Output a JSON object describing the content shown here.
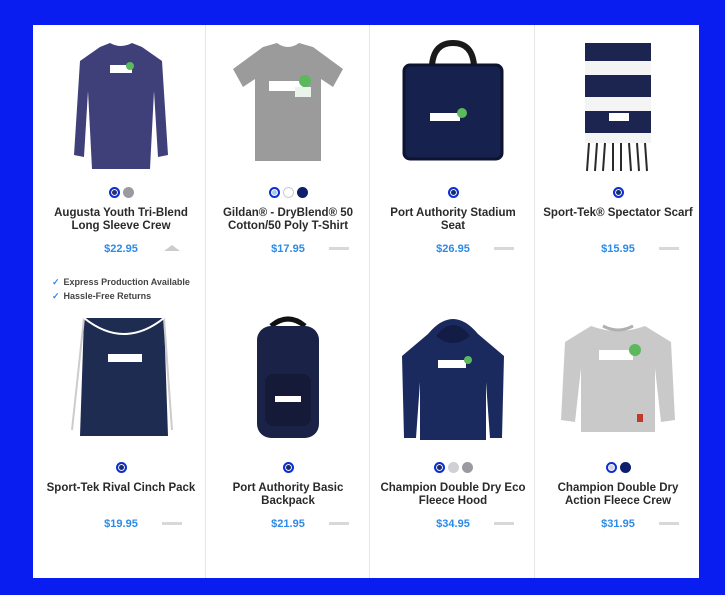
{
  "products": [
    {
      "title": "Augusta Youth Tri-Blend Long Sleeve Crew",
      "price": "$22.95",
      "swatches": [
        "#2a2c77",
        "#9a9aa0"
      ],
      "selected": 0,
      "image": "long-sleeve-shirt-navy"
    },
    {
      "title": "Gildan® - DryBlend® 50 Cotton/50 Poly T-Shirt",
      "price": "$17.95",
      "swatches": [
        "#a7c8ee",
        "#ffffff",
        "#0e1e6a"
      ],
      "selected": 0,
      "image": "tshirt-grey"
    },
    {
      "title": "Port Authority Stadium Seat",
      "price": "$26.95",
      "swatches": [
        "#1b2a6a"
      ],
      "selected": 0,
      "image": "stadium-seat"
    },
    {
      "title": "Sport-Tek® Spectator Scarf",
      "price": "$15.95",
      "swatches": [
        "#1b2a6a"
      ],
      "selected": 0,
      "image": "scarf"
    },
    {
      "title": "Sport-Tek Rival Cinch Pack",
      "price": "$19.95",
      "swatches": [
        "#1b2a6a"
      ],
      "selected": 0,
      "image": "cinch-pack"
    },
    {
      "title": "Port Authority Basic Backpack",
      "price": "$21.95",
      "swatches": [
        "#1b2a6a"
      ],
      "selected": 0,
      "image": "backpack"
    },
    {
      "title": "Champion Double Dry Eco Fleece Hood",
      "price": "$34.95",
      "swatches": [
        "#1b2a6a",
        "#cfd1d6",
        "#9a9aa0"
      ],
      "selected": 0,
      "image": "hoodie"
    },
    {
      "title": "Champion Double Dry Action Fleece Crew",
      "price": "$31.95",
      "swatches": [
        "#cfd1d6",
        "#0e1e6a"
      ],
      "selected": 0,
      "image": "crewneck-grey"
    }
  ],
  "features": [
    "Express Production Available",
    "Hassle-Free Returns"
  ],
  "colors": {
    "frame": "#0a1df0",
    "price": "#2c8ae8",
    "navy": "#1b2a6a"
  }
}
